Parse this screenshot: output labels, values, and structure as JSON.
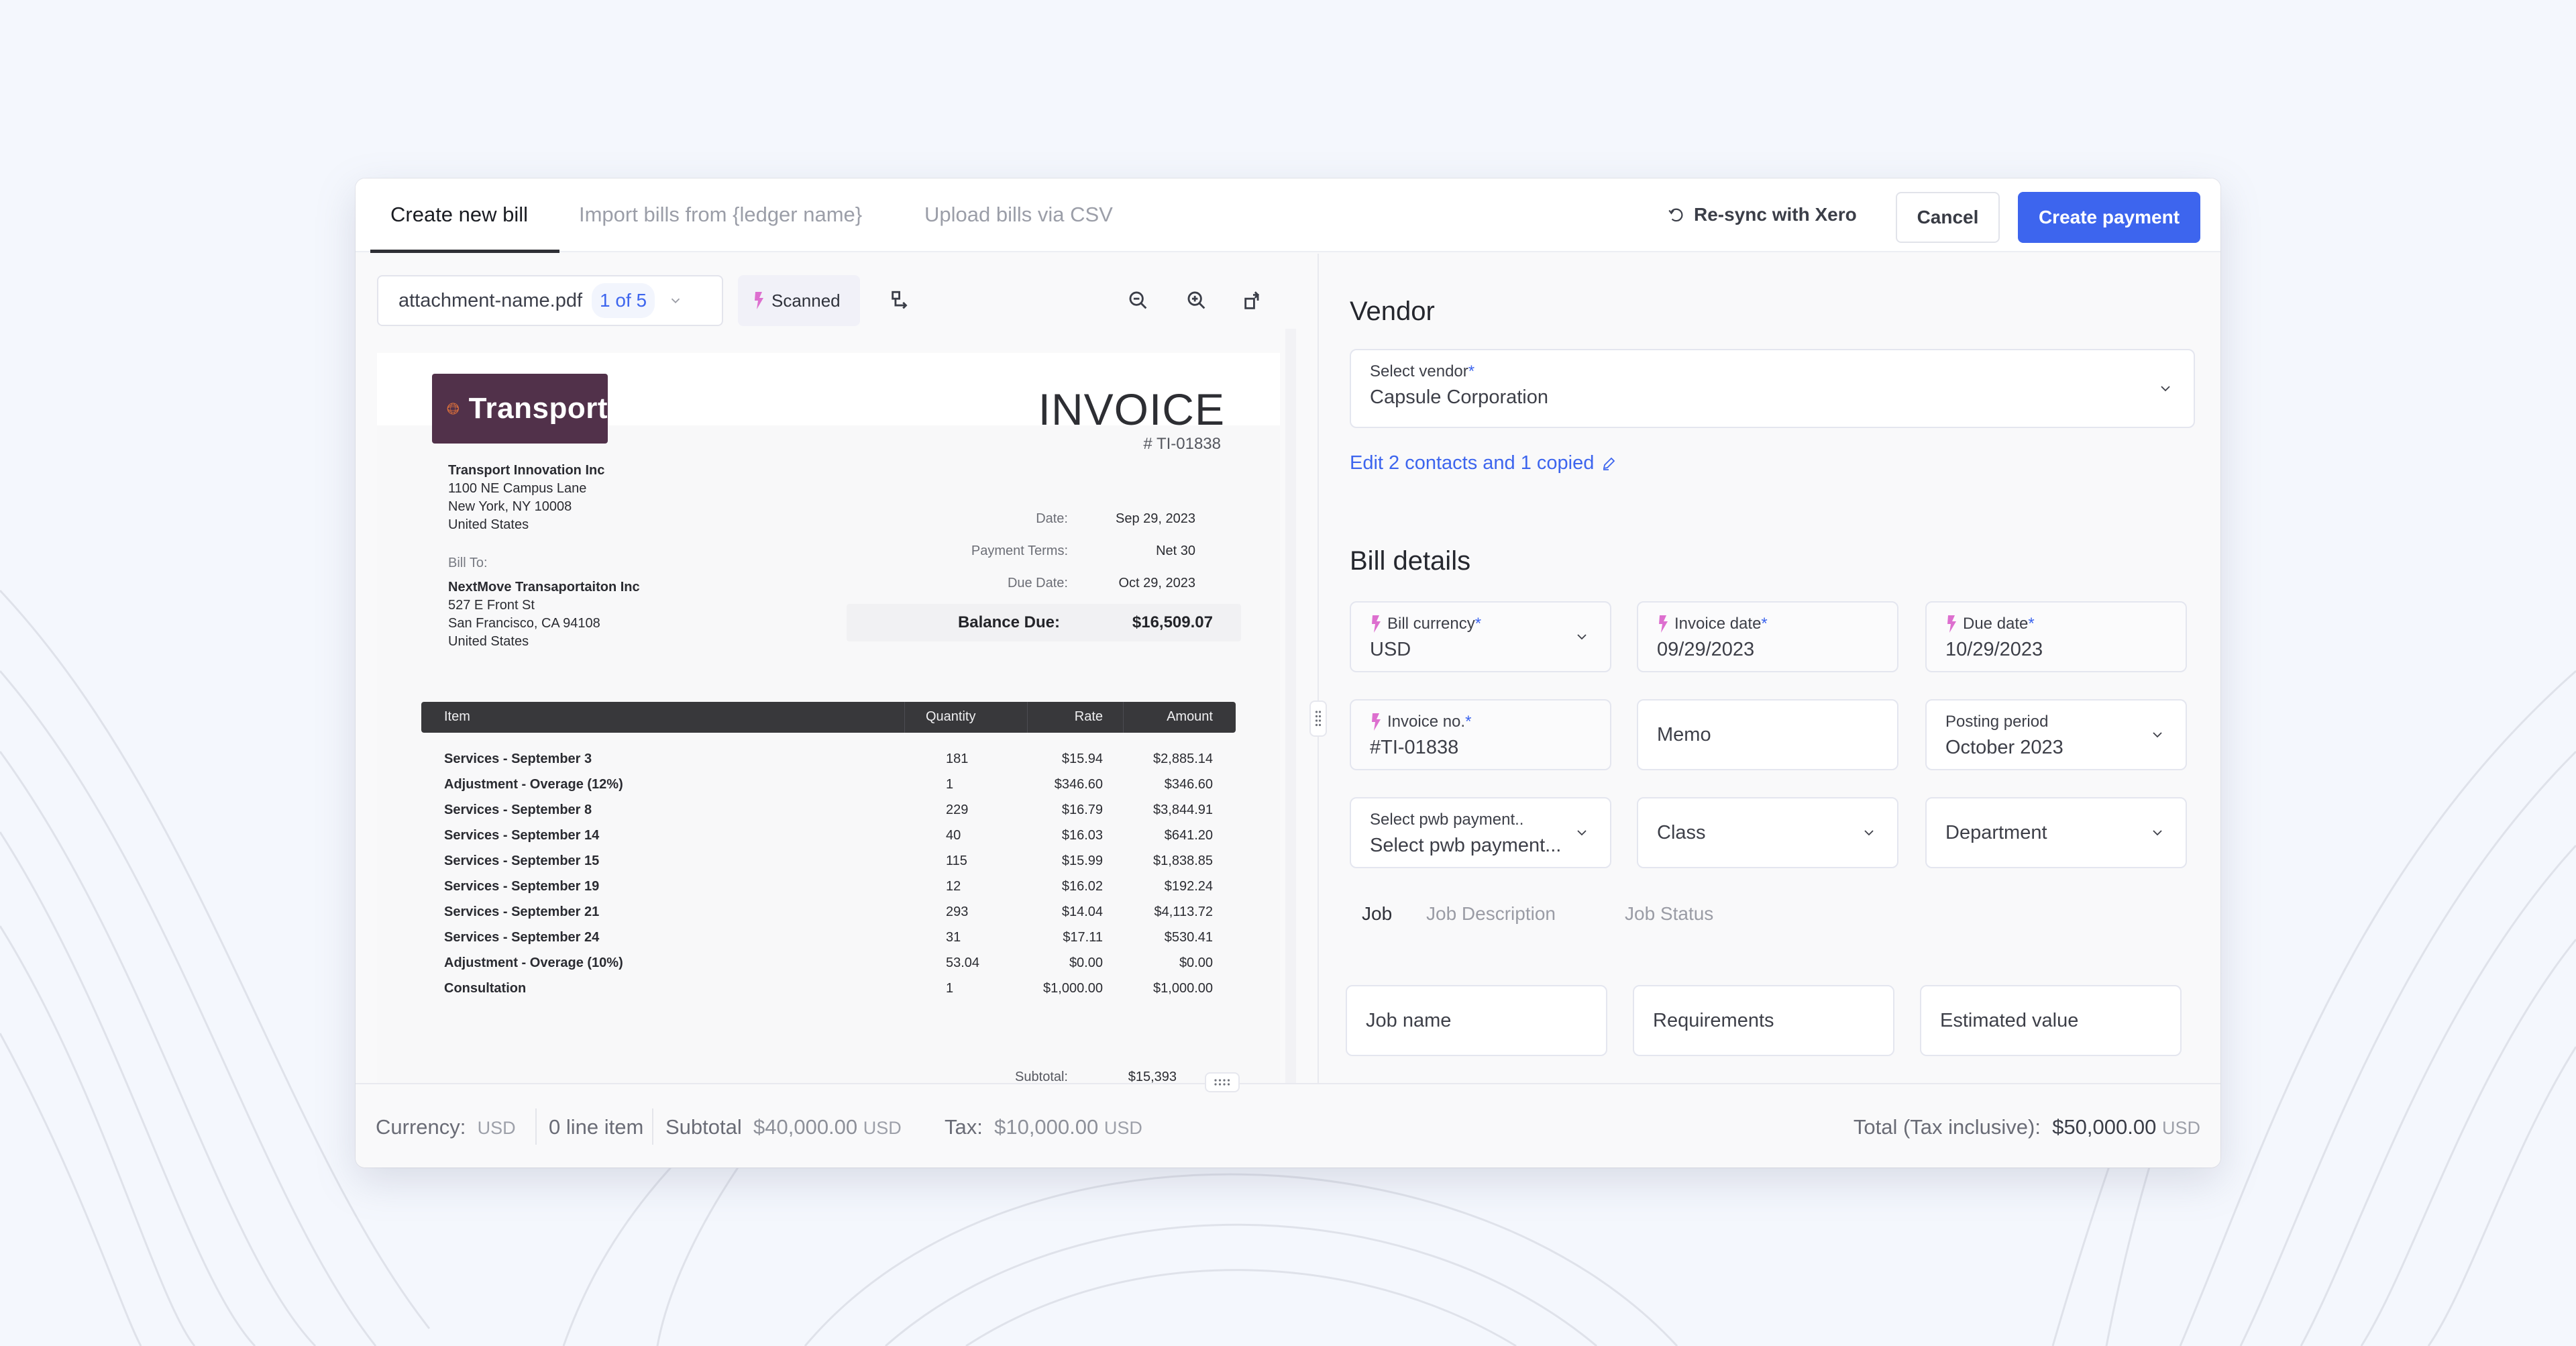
{
  "header": {
    "tabs": [
      {
        "label": "Create new bill",
        "active": true
      },
      {
        "label": "Import bills from {ledger name}",
        "active": false
      },
      {
        "label": "Upload bills via CSV",
        "active": false
      }
    ],
    "resync_label": "Re-sync with Xero",
    "cancel_label": "Cancel",
    "primary_label": "Create payment"
  },
  "viewer": {
    "file_name": "attachment-name.pdf",
    "page_indicator": "1 of 5",
    "scanned_label": "Scanned",
    "icons": [
      "split-icon",
      "zoom-out-icon",
      "zoom-in-icon",
      "rotate-icon"
    ]
  },
  "invoice": {
    "logo_text": "Transport",
    "title": "INVOICE",
    "number": "# TI-01838",
    "from": {
      "name": "Transport Innovation Inc",
      "lines": [
        "1100 NE Campus Lane",
        "New York, NY 10008",
        "United States"
      ]
    },
    "bill_to_label": "Bill To:",
    "to": {
      "name": "NextMove Transaportaiton Inc",
      "lines": [
        "527 E Front St",
        "San Francisco, CA 94108",
        "United States"
      ]
    },
    "meta": [
      {
        "label": "Date:",
        "value": "Sep 29, 2023"
      },
      {
        "label": "Payment Terms:",
        "value": "Net 30"
      },
      {
        "label": "Due Date:",
        "value": "Oct 29, 2023"
      }
    ],
    "balance_label": "Balance Due:",
    "balance_value": "$16,509.07",
    "columns": [
      "Item",
      "Quantity",
      "Rate",
      "Amount"
    ],
    "items": [
      {
        "name": "Services - September 3",
        "qty": "181",
        "rate": "$15.94",
        "amount": "$2,885.14"
      },
      {
        "name": "Adjustment - Overage (12%)",
        "qty": "1",
        "rate": "$346.60",
        "amount": "$346.60"
      },
      {
        "name": "Services - September 8",
        "qty": "229",
        "rate": "$16.79",
        "amount": "$3,844.91"
      },
      {
        "name": "Services - September 14",
        "qty": "40",
        "rate": "$16.03",
        "amount": "$641.20"
      },
      {
        "name": "Services - September 15",
        "qty": "115",
        "rate": "$15.99",
        "amount": "$1,838.85"
      },
      {
        "name": "Services - September 19",
        "qty": "12",
        "rate": "$16.02",
        "amount": "$192.24"
      },
      {
        "name": "Services - September 21",
        "qty": "293",
        "rate": "$14.04",
        "amount": "$4,113.72"
      },
      {
        "name": "Services - September 24",
        "qty": "31",
        "rate": "$17.11",
        "amount": "$530.41"
      },
      {
        "name": "Adjustment - Overage (10%)",
        "qty": "53.04",
        "rate": "$0.00",
        "amount": "$0.00"
      },
      {
        "name": "Consultation",
        "qty": "1",
        "rate": "$1,000.00",
        "amount": "$1,000.00"
      }
    ],
    "subtotal_label": "Subtotal:",
    "subtotal_value": "$15,393"
  },
  "form": {
    "vendor_title": "Vendor",
    "vendor_label": "Select vendor",
    "vendor_value": "Capsule Corporation",
    "edit_contacts": "Edit 2 contacts and 1 copied",
    "details_title": "Bill details",
    "currency_label": "Bill currency",
    "currency_value": "USD",
    "invoice_date_label": "Invoice date",
    "invoice_date_value": "09/29/2023",
    "due_date_label": "Due date",
    "due_date_value": "10/29/2023",
    "invoice_no_label": "Invoice no.",
    "invoice_no_value": "#TI-01838",
    "memo_placeholder": "Memo",
    "posting_label": "Posting period",
    "posting_value": "October 2023",
    "pwb_label": "Select pwb payment..",
    "pwb_value": "Select pwb payment...",
    "class_placeholder": "Class",
    "department_placeholder": "Department",
    "required_mark": "*",
    "subtabs": [
      {
        "label": "Job",
        "active": true
      },
      {
        "label": "Job Description",
        "active": false
      },
      {
        "label": "Job Status",
        "active": false
      }
    ],
    "job_name_placeholder": "Job name",
    "requirements_placeholder": "Requirements",
    "estimated_value_placeholder": "Estimated value"
  },
  "footer": {
    "currency_label": "Currency:",
    "currency_value": "USD",
    "line_items": "0 line item",
    "subtotal_label": "Subtotal",
    "subtotal_value": "$40,000.00",
    "subtotal_unit": "USD",
    "tax_label": "Tax:",
    "tax_value": "$10,000.00",
    "tax_unit": "USD",
    "total_label": "Total (Tax inclusive):",
    "total_value": "$50,000.00",
    "total_unit": "USD"
  },
  "colors": {
    "accent": "#3d65ee",
    "ai_bolt": "#dd6fcf",
    "logo_bg": "#51314a",
    "logo_mark": "#e8763a"
  }
}
